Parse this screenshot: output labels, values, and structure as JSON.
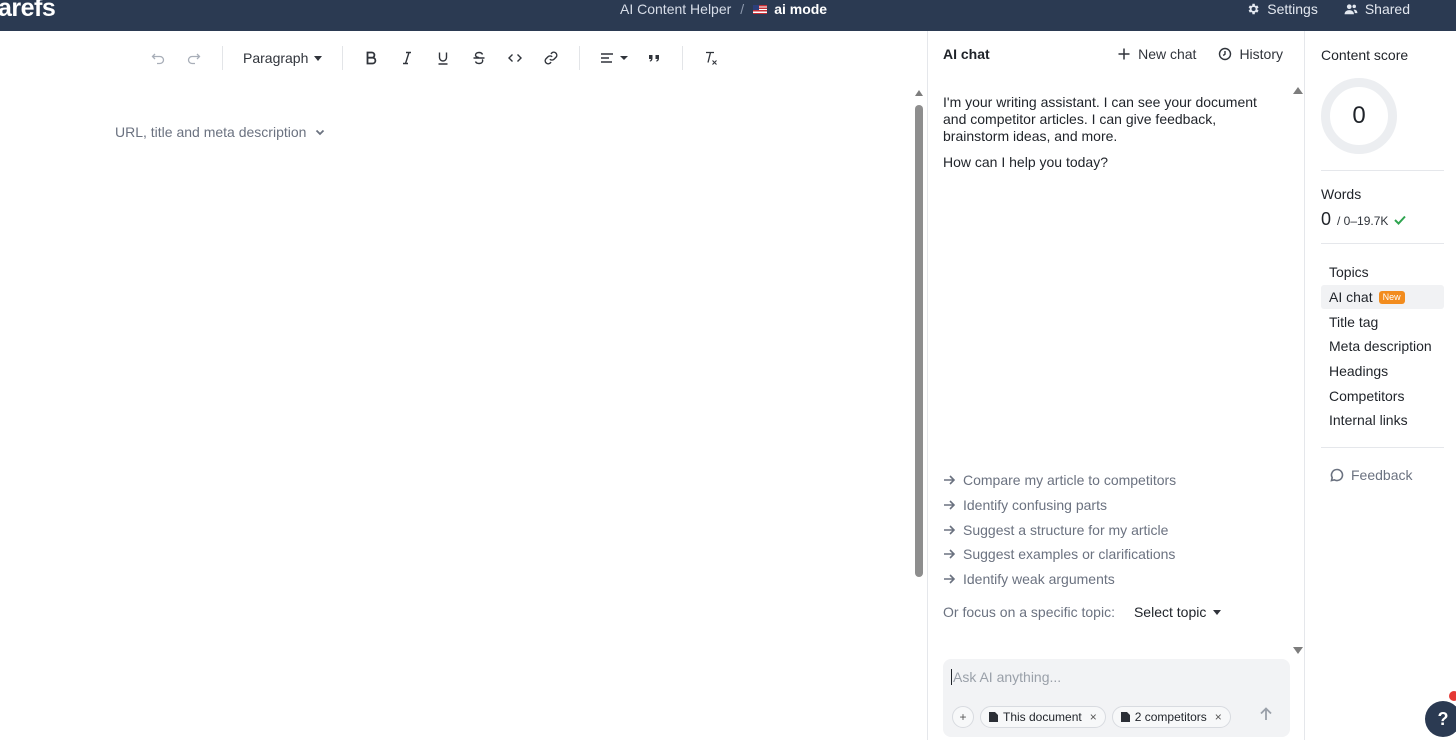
{
  "topbar": {
    "logo": "arefs",
    "app_name": "AI Content Helper",
    "separator": "/",
    "document_name": "ai mode",
    "settings_label": "Settings",
    "shared_label": "Shared"
  },
  "toolbar": {
    "block_format": "Paragraph"
  },
  "editor": {
    "meta_toggle_label": "URL, title and meta description"
  },
  "chat": {
    "title": "AI chat",
    "new_chat_label": "New chat",
    "history_label": "History",
    "messages": [
      "I'm your writing assistant. I can see your document and competitor articles. I can give feedback, brainstorm ideas, and more.",
      "How can I help you today?"
    ],
    "suggestions": [
      "Compare my article to competitors",
      "Identify confusing parts",
      "Suggest a structure for my article",
      "Suggest examples or clarifications",
      "Identify weak arguments"
    ],
    "focus_label": "Or focus on a specific topic:",
    "topic_select_label": "Select topic",
    "input_placeholder": "Ask AI anything...",
    "attach_label": "+",
    "context_chips": [
      "This document",
      "2 competitors"
    ]
  },
  "sidebar": {
    "content_score_label": "Content score",
    "content_score": "0",
    "words_label": "Words",
    "words_count": "0",
    "words_range": "/ 0–19.7K",
    "nav_items": [
      {
        "label": "Topics",
        "active": false
      },
      {
        "label": "AI chat",
        "active": true,
        "badge": "New"
      },
      {
        "label": "Title tag",
        "active": false
      },
      {
        "label": "Meta description",
        "active": false
      },
      {
        "label": "Headings",
        "active": false
      },
      {
        "label": "Competitors",
        "active": false
      },
      {
        "label": "Internal links",
        "active": false
      }
    ],
    "feedback_label": "Feedback"
  },
  "help": {
    "label": "?"
  },
  "colors": {
    "topbar_bg": "#2b3a52",
    "badge_new": "#f28c1e",
    "check_green": "#2ea44f",
    "notification_dot": "#e53935"
  }
}
